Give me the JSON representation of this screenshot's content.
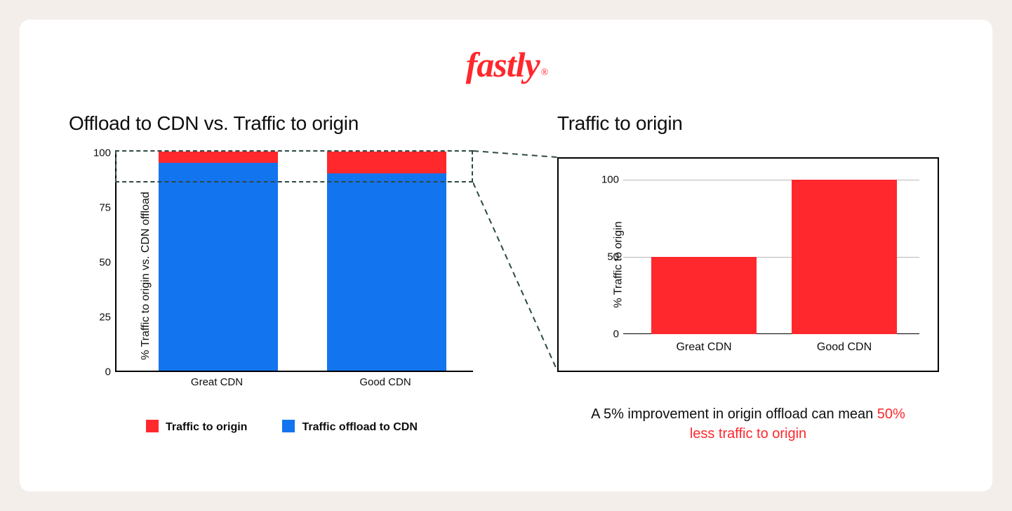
{
  "logo_text": "fastly",
  "logo_reg": "®",
  "left": {
    "title": "Offload to CDN vs. Traffic to origin",
    "ylabel": "% Traffic to origin vs. CDN offload",
    "yticks": [
      "0",
      "25",
      "50",
      "75",
      "100"
    ],
    "xcats": [
      "Great CDN",
      "Good CDN"
    ],
    "legend_red": "Traffic to origin",
    "legend_blue": "Traffic offload to CDN"
  },
  "right": {
    "title": "Traffic to origin",
    "ylabel": "% Traffic to origin",
    "yticks": [
      "0",
      "50",
      "100"
    ],
    "xcats": [
      "Great CDN",
      "Good CDN"
    ]
  },
  "caption_a": "A 5% improvement in origin offload can mean ",
  "caption_b": "50% less traffic to origin",
  "chart_data": [
    {
      "type": "bar",
      "stacked": true,
      "title": "Offload to CDN vs. Traffic to origin",
      "ylabel": "% Traffic to origin vs. CDN offload",
      "ylim": [
        0,
        100
      ],
      "categories": [
        "Great CDN",
        "Good CDN"
      ],
      "series": [
        {
          "name": "Traffic offload to CDN",
          "color": "#1374f0",
          "values": [
            95,
            90
          ]
        },
        {
          "name": "Traffic to origin",
          "color": "#ff282d",
          "values": [
            5,
            10
          ]
        }
      ]
    },
    {
      "type": "bar",
      "title": "Traffic to origin",
      "ylabel": "% Traffic to origin",
      "ylim": [
        0,
        100
      ],
      "categories": [
        "Great CDN",
        "Good CDN"
      ],
      "series": [
        {
          "name": "Traffic to origin",
          "color": "#ff282d",
          "values": [
            50,
            100
          ]
        }
      ]
    }
  ]
}
